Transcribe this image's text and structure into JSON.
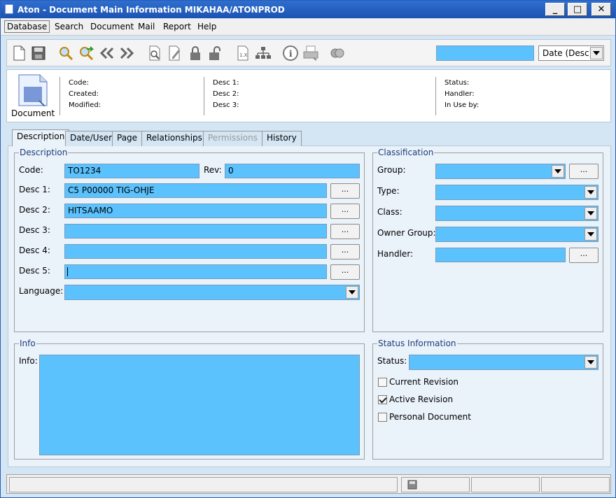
{
  "window": {
    "title": "Aton - Document Main Information MIKAHAA/ATONPROD"
  },
  "menu": [
    "Database",
    "Search",
    "Document",
    "Mail",
    "Report",
    "Help"
  ],
  "toolbar": {
    "sort_value": "Date (Desc)"
  },
  "header": {
    "doc_label": "Document",
    "col1": [
      "Code:",
      "Created:",
      "Modified:"
    ],
    "col2": [
      "Desc 1:",
      "Desc 2:",
      "Desc 3:"
    ],
    "col3": [
      "Status:",
      "Handler:",
      "In Use by:"
    ]
  },
  "tabs": [
    {
      "label": "Description",
      "state": "active"
    },
    {
      "label": "Date/User",
      "state": "normal"
    },
    {
      "label": "Page",
      "state": "normal"
    },
    {
      "label": "Relationships",
      "state": "normal"
    },
    {
      "label": "Permissions",
      "state": "disabled"
    },
    {
      "label": "History",
      "state": "normal"
    }
  ],
  "description": {
    "title": "Description",
    "code_label": "Code:",
    "code_value": "TO1234",
    "rev_label": "Rev:",
    "rev_value": "0",
    "desc1_label": "Desc 1:",
    "desc1_value": "C5 P00000 TIG-OHJE",
    "desc2_label": "Desc 2:",
    "desc2_value": "HITSAAMO",
    "desc3_label": "Desc 3:",
    "desc3_value": "",
    "desc4_label": "Desc 4:",
    "desc4_value": "",
    "desc5_label": "Desc 5:",
    "desc5_value": "",
    "language_label": "Language:",
    "ellipsis": "..."
  },
  "classification": {
    "title": "Classification",
    "group_label": "Group:",
    "type_label": "Type:",
    "class_label": "Class:",
    "owner_group_label": "Owner Group:",
    "handler_label": "Handler:",
    "ellipsis": "..."
  },
  "info": {
    "title": "Info",
    "label": "Info:"
  },
  "status_info": {
    "title": "Status Information",
    "status_label": "Status:",
    "current_revision": {
      "label": "Current Revision",
      "checked": false
    },
    "active_revision": {
      "label": "Active Revision",
      "checked": true
    },
    "personal_document": {
      "label": "Personal Document",
      "checked": false
    }
  },
  "colors": {
    "field": "#5bc2fd",
    "titlebar": "#1c53b0",
    "panel": "#eaf2fa"
  },
  "icons": [
    "new-doc-icon",
    "save-icon",
    "search-icon",
    "search-next-icon",
    "first-icon",
    "last-icon",
    "preview-icon",
    "edit-icon",
    "lock-icon",
    "unlock-icon",
    "version-icon",
    "structure-icon",
    "info-icon",
    "print-icon",
    "link-icon"
  ]
}
